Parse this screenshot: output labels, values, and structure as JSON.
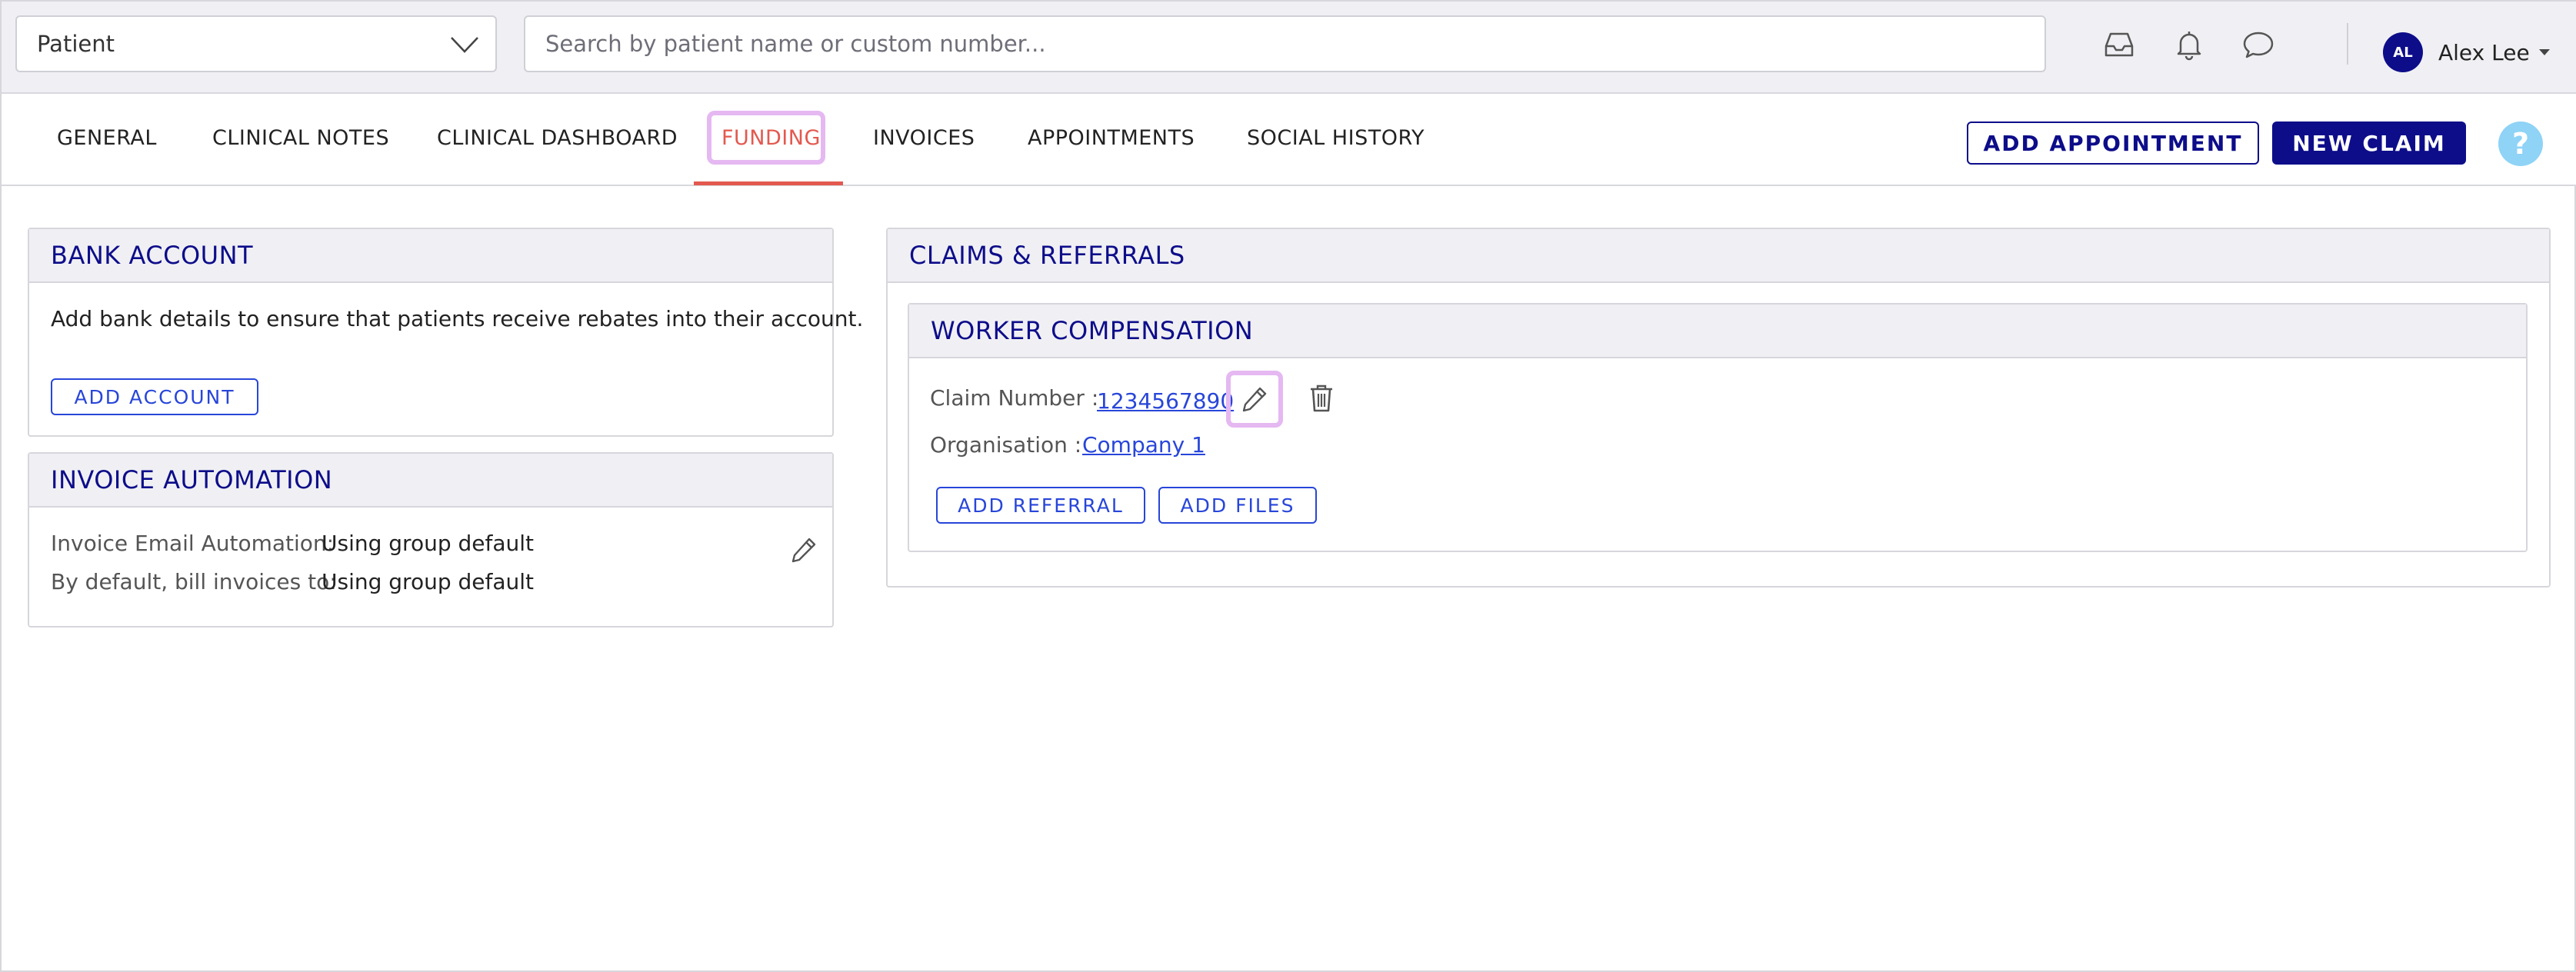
{
  "topbar": {
    "patient_select": {
      "value": "Patient",
      "icon": "chevron-down-icon"
    },
    "search": {
      "placeholder": "Search by patient name or custom number..."
    },
    "icons": [
      "inbox-icon",
      "bell-icon",
      "chat-bubble-icon"
    ],
    "user": {
      "initials": "AL",
      "name": "Alex Lee"
    }
  },
  "tabs": [
    {
      "label": "GENERAL",
      "active": false
    },
    {
      "label": "CLINICAL NOTES",
      "active": false
    },
    {
      "label": "CLINICAL DASHBOARD",
      "active": false
    },
    {
      "label": "FUNDING",
      "active": true
    },
    {
      "label": "INVOICES",
      "active": false
    },
    {
      "label": "APPOINTMENTS",
      "active": false
    },
    {
      "label": "SOCIAL HISTORY",
      "active": false
    }
  ],
  "actions": {
    "add_appointment": "ADD APPOINTMENT",
    "new_claim": "NEW CLAIM",
    "help": "?"
  },
  "bank_account": {
    "title": "BANK ACCOUNT",
    "description": "Add bank details to ensure that patients receive rebates into their account.",
    "add_button": "ADD ACCOUNT"
  },
  "invoice_automation": {
    "title": "INVOICE AUTOMATION",
    "rows": [
      {
        "label": "Invoice Email Automation:",
        "value": "Using group default"
      },
      {
        "label": "By default, bill invoices to:",
        "value": "Using group default"
      }
    ]
  },
  "claims": {
    "title": "CLAIMS & REFERRALS",
    "worker_compensation": {
      "title": "WORKER COMPENSATION",
      "claim_number_label": "Claim Number :",
      "claim_number": "1234567890",
      "organisation_label": "Organisation :",
      "organisation": "Company 1",
      "add_referral": "ADD REFERRAL",
      "add_files": "ADD FILES"
    }
  },
  "colors": {
    "brand_navy": "#0d0d8a",
    "active_tab": "#e3594f",
    "link_blue": "#2846d9",
    "highlight": "#e5b8f2",
    "help_blue": "#8fd3f6"
  }
}
